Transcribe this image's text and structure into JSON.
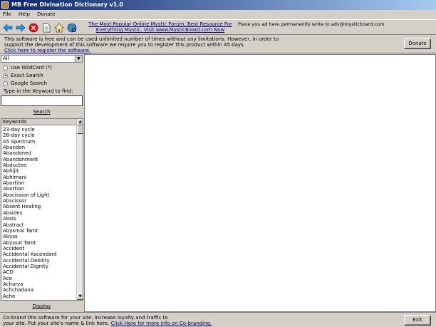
{
  "window": {
    "title": "MB Free Divination Dictionary v1.0",
    "icon": "app-icon"
  },
  "menu": [
    "File",
    "Help",
    "Donate"
  ],
  "toolbar": {
    "icons": [
      "back-arrow-icon",
      "forward-arrow-icon",
      "stop-icon",
      "document-icon",
      "home-icon",
      "globe-icon"
    ],
    "ad_link": "The Most Popular Online Mystic Forum. Best Resource For Everything Mystic. Visit www.MysticBoard.com Now",
    "ad_text": "Place you ad here permanently write to adv@mysticboard.com"
  },
  "notice": {
    "line1": "This software is free and can be used unlimited number of times without any limitations. However, in order to",
    "line2": "support the development of this software we require you to register this product within 45 days.",
    "register_link": "Click here to register the software.",
    "donate_label": "Donate"
  },
  "left": {
    "filter_value": "All",
    "radio_wildcard": "Use WildCard (*)",
    "radio_exact": "Exact Search",
    "radio_google": "Google Search",
    "selected_radio": "Exact Search",
    "keyword_label": "Type in the Keyword to find:",
    "keyword_value": "",
    "search_label": "Search",
    "list_header": "Keywords",
    "keywords": [
      "23-day cycle",
      "28-day cycle",
      "A5 Spectrum",
      "Abandon",
      "Abandoned",
      "Abandonment",
      "Abductee",
      "Abhijit",
      "Abhimani",
      "Abortion",
      "Abortion",
      "Abscission of Light",
      "Abscissor",
      "Absent Healing",
      "Absides",
      "Absis",
      "Abstract",
      "Abysmal Tarot",
      "Abyss",
      "Abyssal Tarot",
      "Accident",
      "Accidental Ascendant",
      "Accidental Debility",
      "Accidental Dignity",
      "ACD",
      "Ace",
      "Acharya",
      "Achchadana",
      "Ache"
    ],
    "display_label": "Display"
  },
  "footer": {
    "line1": "Co-brand this software for your site.  Increase loyalty and traffic to",
    "line2_prefix": "your site. Put your site's name &  link here.",
    "cobrand_link": "Click Here for more info on Co-branding.",
    "exit_label": "Exit"
  },
  "colors": {
    "titlebar_start": "#0a246a",
    "titlebar_end": "#a6caf0",
    "link": "#00007f",
    "face": "#d4d0c8"
  }
}
